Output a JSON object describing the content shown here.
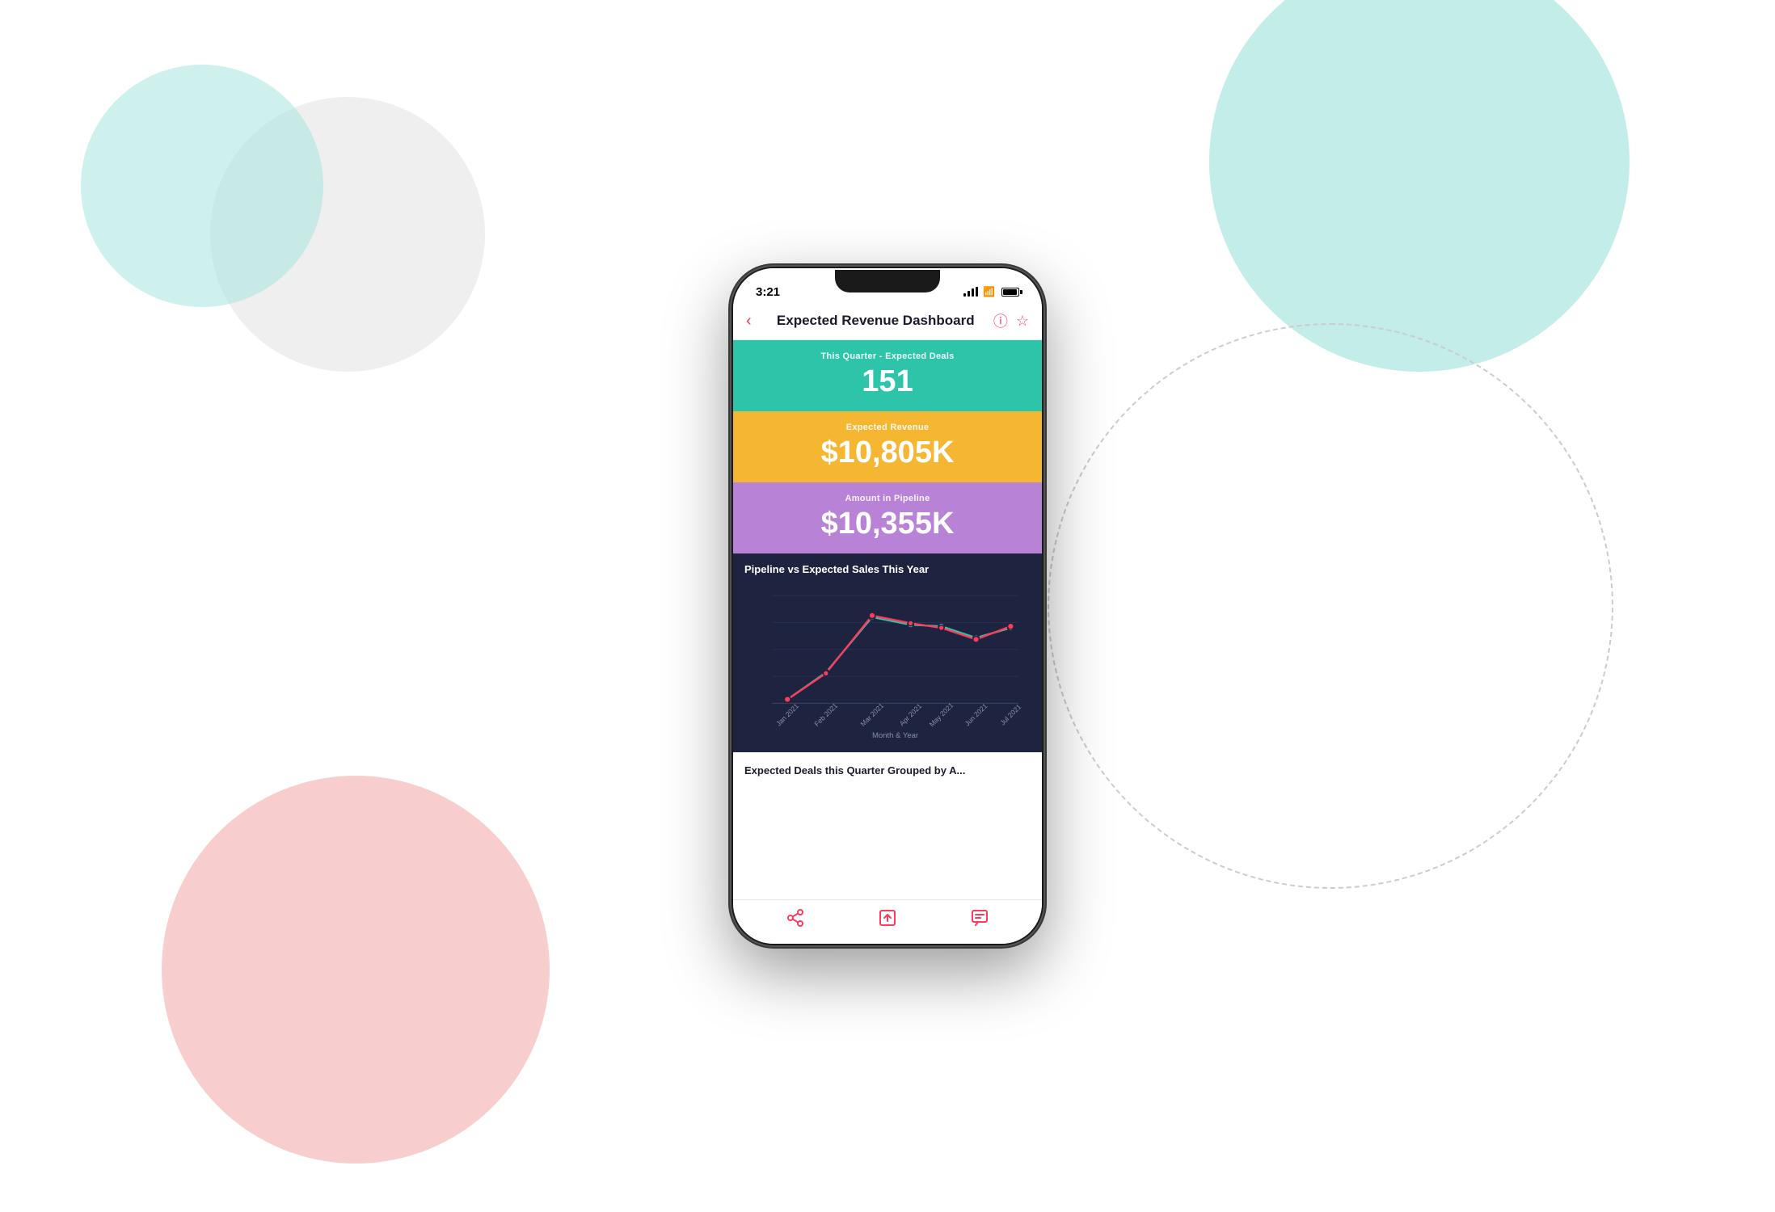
{
  "background": {
    "teal_top_right": "teal circle top right",
    "pink_bottom_left": "pink circle bottom left"
  },
  "phone": {
    "status_bar": {
      "time": "3:21",
      "signal": "signal bars",
      "wifi": "wifi",
      "battery": "battery"
    },
    "header": {
      "back_label": "‹",
      "title": "Expected Revenue Dashboard",
      "info_icon": "ⓘ",
      "star_icon": "☆"
    },
    "cards": {
      "deals": {
        "label": "This Quarter - Expected Deals",
        "value": "151"
      },
      "revenue": {
        "label": "Expected Revenue",
        "value": "$10,805K"
      },
      "pipeline": {
        "label": "Amount in Pipeline",
        "value": "$10,355K"
      }
    },
    "chart": {
      "title": "Pipeline vs Expected Sales This Year",
      "x_axis_label": "Month & Year",
      "months": [
        "Jan 2021",
        "Feb 2021",
        "Mar 2021",
        "Apr 2021",
        "May 2021",
        "Jun 2021",
        "Jul 2021"
      ],
      "pipeline_data": [
        10,
        45,
        88,
        80,
        78,
        65,
        76
      ],
      "expected_data": [
        10,
        44,
        89,
        81,
        77,
        64,
        77
      ]
    },
    "bottom_section": {
      "title": "Expected Deals this Quarter Grouped by A..."
    },
    "bottom_nav": {
      "share_icon": "share",
      "export_icon": "export",
      "comment_icon": "comment"
    }
  }
}
